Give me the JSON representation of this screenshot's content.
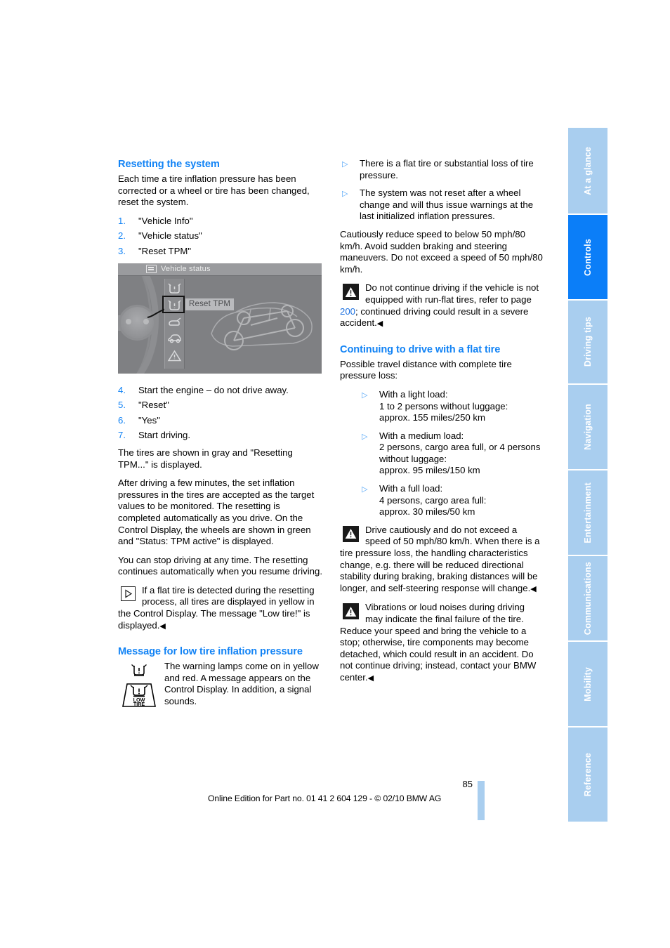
{
  "page": {
    "number": "85",
    "footer_text": "Online Edition for Part no. 01 41 2 604 129 - © 02/10 BMW AG"
  },
  "tabs": [
    {
      "label": "At a glance",
      "active": false
    },
    {
      "label": "Controls",
      "active": true
    },
    {
      "label": "Driving tips",
      "active": false
    },
    {
      "label": "Navigation",
      "active": false
    },
    {
      "label": "Entertainment",
      "active": false
    },
    {
      "label": "Communications",
      "active": false
    },
    {
      "label": "Mobility",
      "active": false
    },
    {
      "label": "Reference",
      "active": false
    }
  ],
  "left_column": {
    "heading_resetting": "Resetting the system",
    "intro": "Each time a tire inflation pressure has been corrected or a wheel or tire has been changed, reset the system.",
    "steps_first": [
      {
        "num": "1.",
        "text": "\"Vehicle Info\""
      },
      {
        "num": "2.",
        "text": "\"Vehicle status\""
      },
      {
        "num": "3.",
        "text": "\"Reset TPM\""
      }
    ],
    "illustration": {
      "display_title": "Vehicle status",
      "selected_item_label": "Reset TPM"
    },
    "steps_second": [
      {
        "num": "4.",
        "text": "Start the engine – do not drive away."
      },
      {
        "num": "5.",
        "text": "\"Reset\""
      },
      {
        "num": "6.",
        "text": "\"Yes\""
      },
      {
        "num": "7.",
        "text": "Start driving."
      }
    ],
    "para_tires_gray": "The tires are shown in gray and \"Resetting TPM...\" is displayed.",
    "para_after_driving": "After driving a few minutes, the set inflation pressures in the tires are accepted as the target values to be monitored. The resetting is completed automatically as you drive. On the Control Display, the wheels are shown in green and \"Status: TPM active\" is displayed.",
    "para_stop_driving": "You can stop driving at any time. The resetting continues automatically when you resume driving.",
    "note_flat_tire": "If a flat tire is detected during the resetting process, all tires are displayed in yellow in the Control Display. The message \"Low tire!\" is displayed.",
    "heading_message_low": "Message for low tire inflation pressure",
    "lamp_text": "The warning lamps come on in yellow and red. A message appears on the Control Display. In addition, a signal sounds.",
    "lamp_icon_caption_line1": "LOW",
    "lamp_icon_caption_line2": "TIRE"
  },
  "right_column": {
    "causes": [
      "There is a flat tire or substantial loss of tire pressure.",
      "The system was not reset after a wheel change and will thus issue warnings at the last initialized inflation pressures."
    ],
    "para_reduce_speed": "Cautiously reduce speed to below 50 mph/80 km/h. Avoid sudden braking and steering maneuvers. Do not exceed a speed of 50 mph/80 km/h.",
    "warning_runflat": {
      "before_ref": "Do not continue driving if the vehicle is not equipped with run-flat tires, refer to page ",
      "page_ref": "200",
      "after_ref": "; continued driving could result in a severe accident."
    },
    "heading_continuing": "Continuing to drive with a flat tire",
    "para_possible_distance": "Possible travel distance with complete tire pressure loss:",
    "loads": [
      {
        "line1": "With a light load:",
        "line2": "1 to 2 persons without luggage:",
        "line3": "approx. 155 miles/250 km"
      },
      {
        "line1": "With a medium load:",
        "line2": "2 persons, cargo area full, or 4 persons without luggage:",
        "line3": "approx. 95 miles/150 km"
      },
      {
        "line1": "With a full load:",
        "line2": "4 persons, cargo area full:",
        "line3": "approx. 30 miles/50 km"
      }
    ],
    "warning_drive_cautiously": "Drive cautiously and do not exceed a speed of 50 mph/80 km/h. When there is a tire pressure loss, the handling characteristics change, e.g. there will be reduced directional stability during braking, braking distances will be longer, and self-steering response will change.",
    "warning_vibrations": "Vibrations or loud noises during driving may indicate the final failure of the tire. Reduce your speed and bring the vehicle to a stop; otherwise, tire components may become detached, which could result in an accident. Do not continue driving; instead, contact your BMW center."
  },
  "symbols": {
    "bullet_triangle": "▷",
    "end_mark": "◀"
  },
  "colors": {
    "heading_blue": "#1283f5",
    "tab_inactive": "#a9ceef",
    "tab_active": "#0b7ef8",
    "page_ref_blue": "#1a6fe0"
  }
}
